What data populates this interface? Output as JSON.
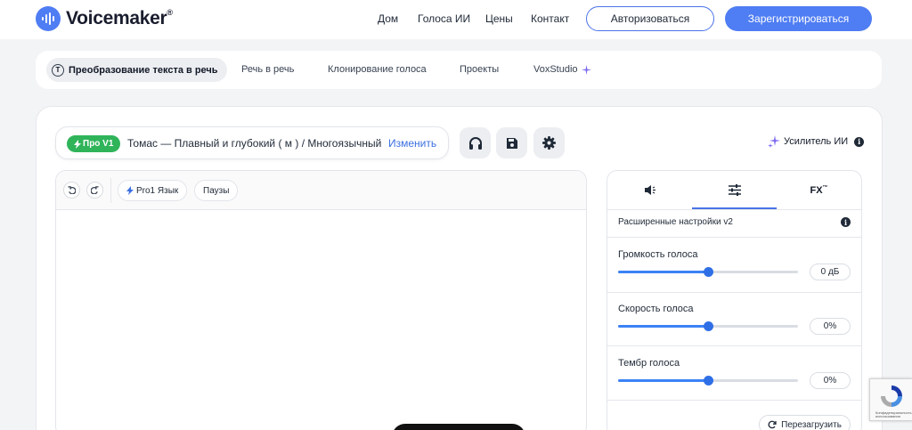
{
  "header": {
    "logo_text": "Voicemaker",
    "logo_mark": "®",
    "nav": [
      "Дом",
      "Голоса ИИ",
      "Цены",
      "Контакт"
    ],
    "login_label": "Авторизоваться",
    "signup_label": "Зарегистрироваться"
  },
  "modes": {
    "active_icon": "T",
    "active": "Преобразование текста в речь",
    "items": [
      "Речь в речь",
      "Клонирование голоса",
      "Проекты",
      "VoxStudio"
    ]
  },
  "voice": {
    "badge": "Про V1",
    "name": "Томас — Плавный и глубокий ( м ) / Многоязычный",
    "change_label": "Изменить"
  },
  "enhancer": {
    "label": "Усилитель ИИ",
    "info": "i"
  },
  "editor": {
    "pro1_lang": "Pro1 Язык",
    "pauses": "Паузы"
  },
  "panel": {
    "fx_label": "FX",
    "fx_sup": "™",
    "title": "Расширенные настройки v2",
    "info": "i",
    "controls": [
      {
        "label": "Громкость голоса",
        "value": "0 дБ",
        "level": 0.5
      },
      {
        "label": "Скорость голоса",
        "value": "0%",
        "level": 0.5
      },
      {
        "label": "Тембр голоса",
        "value": "0%",
        "level": 0.5
      }
    ],
    "reset_label": "Перезагрузить"
  },
  "recaptcha": {
    "text": "Конфиденциальность - Условия использования"
  },
  "colors": {
    "accent": "#4f7df3",
    "pro_badge": "#2fb45a",
    "slider": "#2f6fe6"
  }
}
